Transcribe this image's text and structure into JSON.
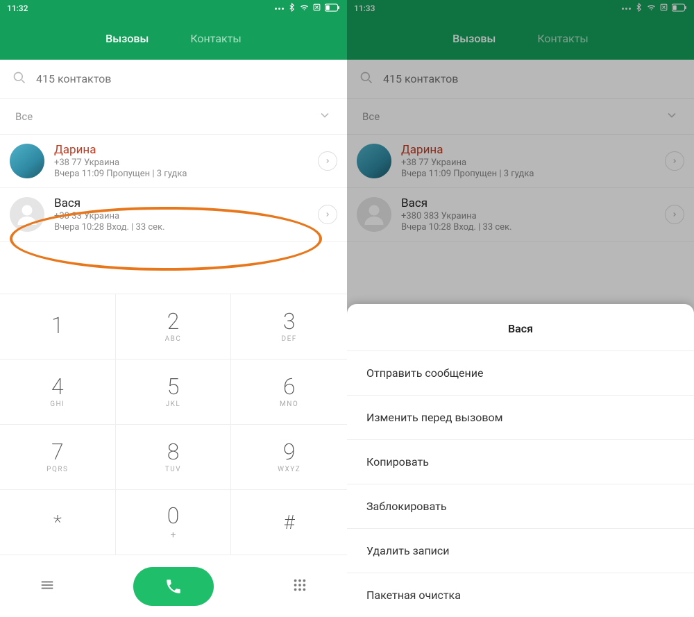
{
  "left": {
    "statusbar": {
      "time": "11:32"
    },
    "tabs": {
      "calls": "Вызовы",
      "contacts": "Контакты"
    },
    "search": {
      "placeholder": "415 контактов"
    },
    "filter": {
      "label": "Все"
    },
    "calls": [
      {
        "name": "Дарина",
        "missed": true,
        "sub1": "+38               77  Украина",
        "sub2": "Вчера 11:09 Пропущен | 3 гудка"
      },
      {
        "name": "Вася",
        "missed": false,
        "sub1": "+38               33  Украина",
        "sub2": "Вчера 10:28 Вход. | 33 сек."
      }
    ],
    "dialpad": {
      "keys": [
        {
          "n": "1",
          "l": ""
        },
        {
          "n": "2",
          "l": "ABC"
        },
        {
          "n": "3",
          "l": "DEF"
        },
        {
          "n": "4",
          "l": "GHI"
        },
        {
          "n": "5",
          "l": "JKL"
        },
        {
          "n": "6",
          "l": "MNO"
        },
        {
          "n": "7",
          "l": "PQRS"
        },
        {
          "n": "8",
          "l": "TUV"
        },
        {
          "n": "9",
          "l": "WXYZ"
        },
        {
          "n": "*",
          "l": ""
        },
        {
          "n": "0",
          "l": "+"
        },
        {
          "n": "#",
          "l": ""
        }
      ]
    }
  },
  "right": {
    "statusbar": {
      "time": "11:33"
    },
    "tabs": {
      "calls": "Вызовы",
      "contacts": "Контакты"
    },
    "search": {
      "placeholder": "415 контактов"
    },
    "filter": {
      "label": "Все"
    },
    "calls": [
      {
        "name": "Дарина",
        "missed": true,
        "sub1": "+38               77  Украина",
        "sub2": "Вчера 11:09 Пропущен | 3 гудка"
      },
      {
        "name": "Вася",
        "missed": false,
        "sub1": "+380             383  Украина",
        "sub2": "Вчера 10:28 Вход. | 33 сек."
      }
    ],
    "menu": {
      "title": "Вася",
      "items": [
        "Отправить сообщение",
        "Изменить перед вызовом",
        "Копировать",
        "Заблокировать",
        "Удалить записи",
        "Пакетная очистка"
      ]
    }
  }
}
